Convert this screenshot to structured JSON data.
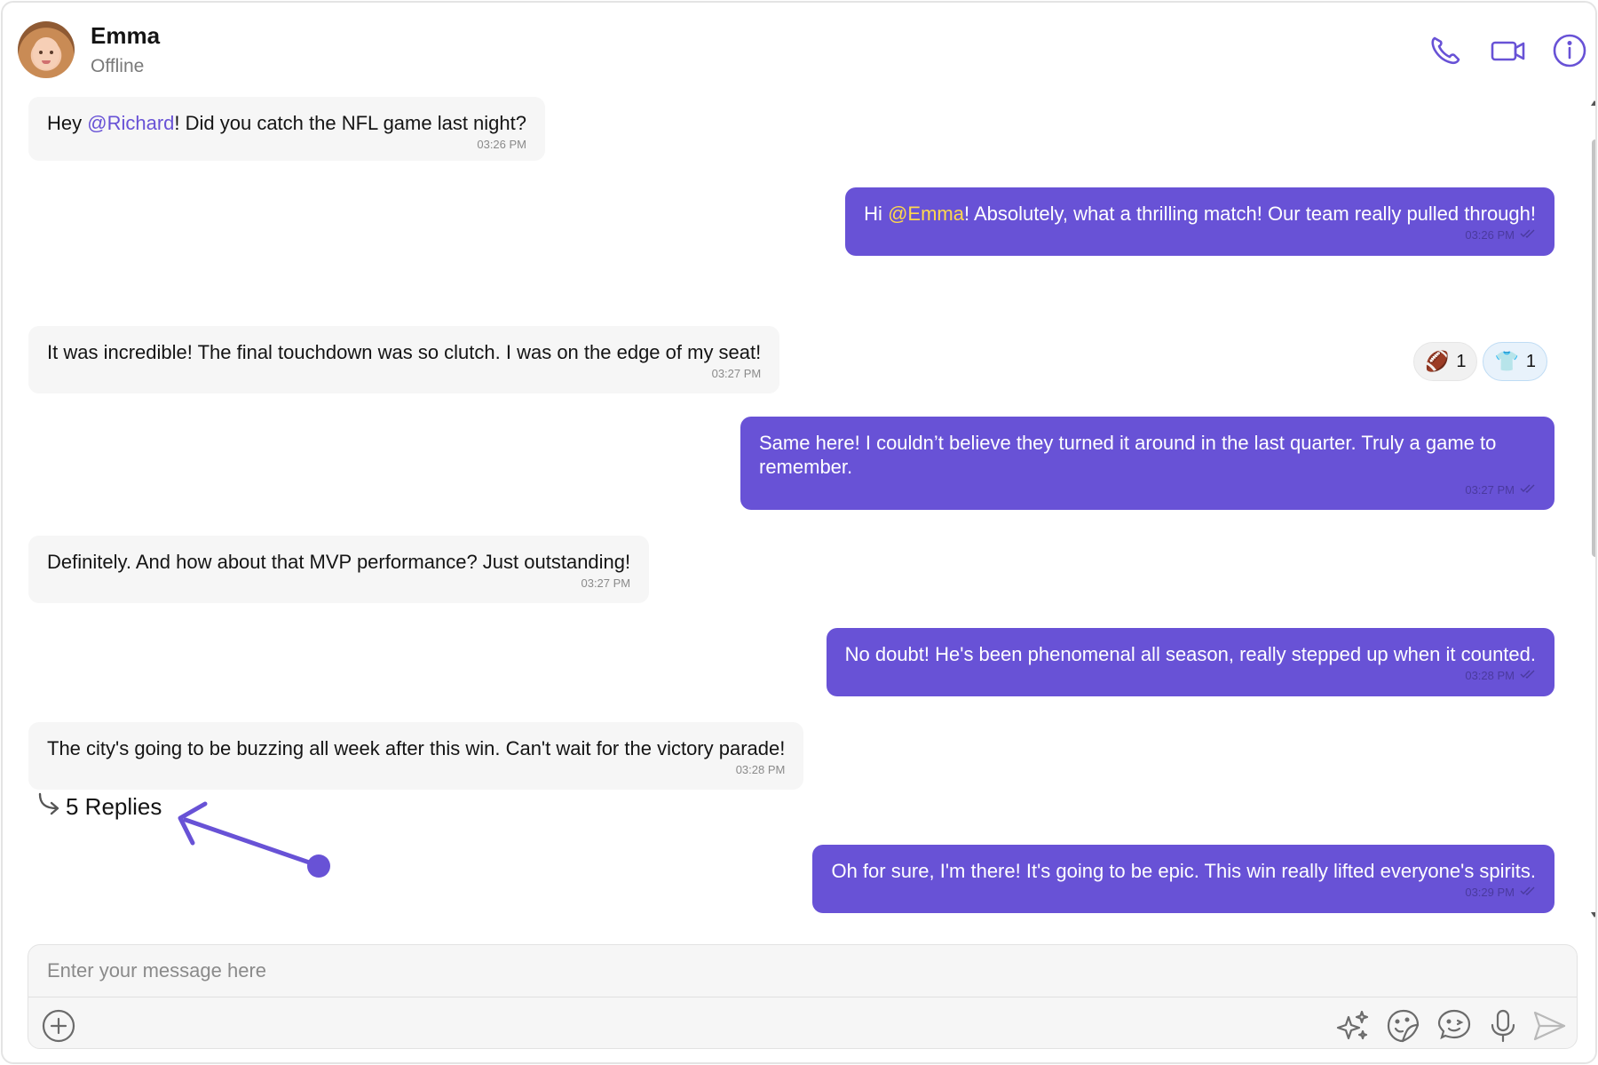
{
  "contact": {
    "name": "Emma",
    "status": "Offline"
  },
  "header_icons": [
    "phone-icon",
    "video-icon",
    "info-icon"
  ],
  "messages": [
    {
      "side": "in",
      "parts": [
        "Hey ",
        "@Richard",
        "! Did you catch the NFL game last night?"
      ],
      "time": "03:26 PM"
    },
    {
      "side": "out",
      "parts": [
        "Hi ",
        "@Emma",
        "! Absolutely, what a thrilling match! Our team really pulled through!"
      ],
      "time": "03:26 PM"
    },
    {
      "side": "in",
      "text": "It was incredible! The final touchdown was so clutch. I was on the edge of my seat!",
      "time": "03:27 PM"
    },
    {
      "side": "out",
      "text": "Same here! I couldn’t believe they turned it around in the last quarter. Truly a game to remember.",
      "time": "03:27 PM"
    },
    {
      "side": "in",
      "text": "Definitely. And how about that MVP performance? Just outstanding!",
      "time": "03:27 PM"
    },
    {
      "side": "out",
      "text": "No doubt! He's been phenomenal all season, really stepped up when it counted.",
      "time": "03:28 PM"
    },
    {
      "side": "in",
      "text": "The city's going to be buzzing all week after this win. Can't wait for the victory parade!",
      "time": "03:28 PM"
    },
    {
      "side": "out",
      "text": "Oh for sure, I'm there! It's going to be epic. This win really lifted everyone's spirits.",
      "time": "03:29 PM"
    }
  ],
  "reactions": [
    {
      "emoji": "🏈",
      "count": "1"
    },
    {
      "emoji": "👕",
      "count": "1"
    }
  ],
  "thread": {
    "replies_label": "5 Replies"
  },
  "composer": {
    "placeholder": "Enter your message here",
    "icons": [
      "add-attachment-icon",
      "ai-sparkle-icon",
      "sticker-icon",
      "emoji-icon",
      "microphone-icon",
      "send-icon"
    ]
  },
  "colors": {
    "accent": "#6852d6",
    "incoming_bubble": "#f6f6f6",
    "mention_out": "#ffd84d"
  }
}
